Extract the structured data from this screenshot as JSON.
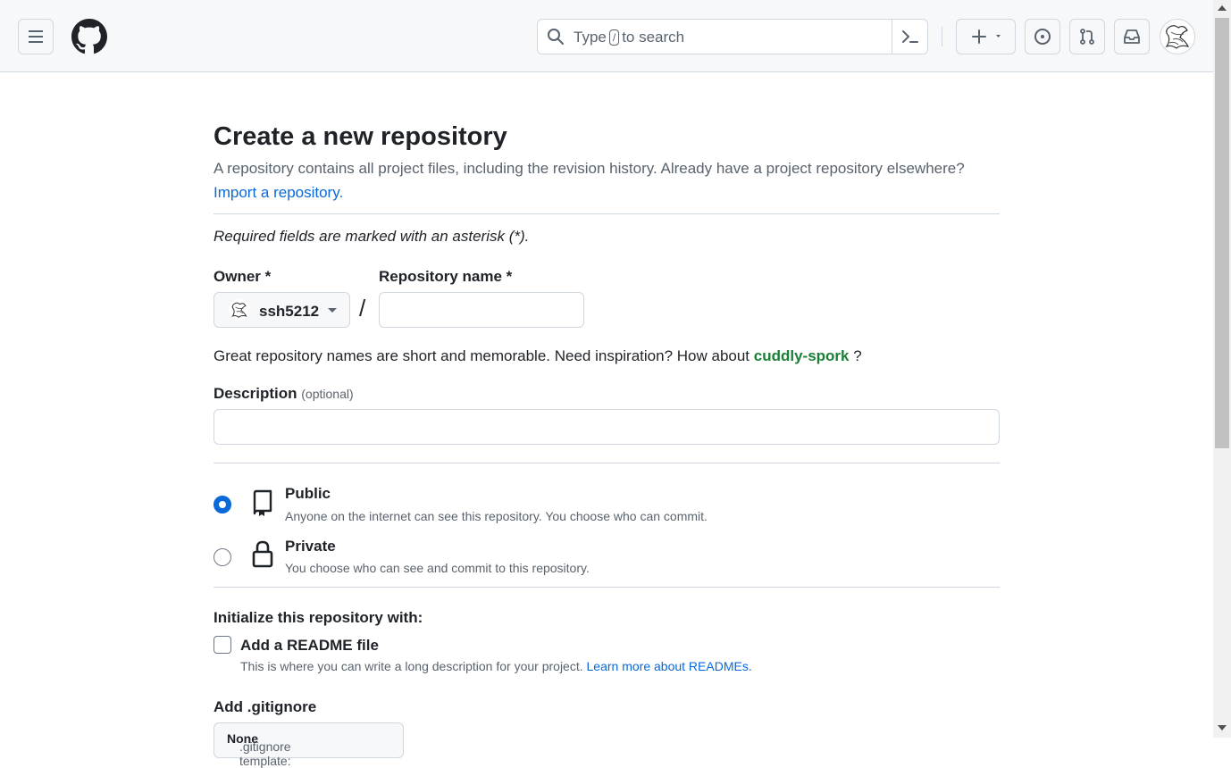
{
  "header": {
    "search_placeholder_before": "Type",
    "search_key": "/",
    "search_placeholder_after": "to search"
  },
  "page": {
    "title": "Create a new repository",
    "subtitle": "A repository contains all project files, including the revision history. Already have a project repository elsewhere?",
    "import_link": "Import a repository.",
    "required_note": "Required fields are marked with an asterisk (*)."
  },
  "form": {
    "owner_label": "Owner *",
    "owner_value": "ssh5212",
    "separator": "/",
    "repo_name_label": "Repository name *",
    "repo_name_value": "",
    "inspiration_text": "Great repository names are short and memorable. Need inspiration? How about",
    "suggested_name": "cuddly-spork",
    "inspiration_end": "?",
    "description_label": "Description",
    "description_optional": "(optional)",
    "description_value": ""
  },
  "visibility": {
    "selected": "public",
    "options": [
      {
        "title": "Public",
        "desc": "Anyone on the internet can see this repository. You choose who can commit.",
        "icon": "repo-icon"
      },
      {
        "title": "Private",
        "desc": "You choose who can see and commit to this repository.",
        "icon": "lock-icon"
      }
    ]
  },
  "initialize": {
    "heading": "Initialize this repository with:",
    "readme_label": "Add a README file",
    "readme_checked": false,
    "readme_desc": "This is where you can write a long description for your project.",
    "readme_link": "Learn more about READMEs.",
    "gitignore_label": "Add .gitignore",
    "gitignore_prefix": ".gitignore template:",
    "gitignore_value": "None"
  },
  "colors": {
    "accent": "#0969da",
    "suggestion": "#1a7f37",
    "border": "#d0d7de",
    "muted_text": "#59636e"
  }
}
